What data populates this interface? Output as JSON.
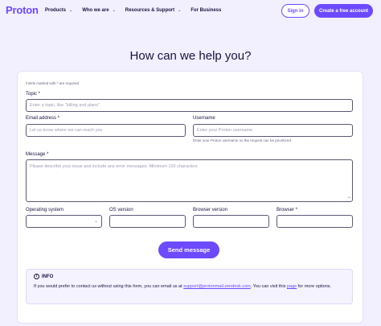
{
  "nav": {
    "logo": "Proton",
    "items": [
      {
        "label": "Products",
        "has_dropdown": true
      },
      {
        "label": "Who we are",
        "has_dropdown": true
      },
      {
        "label": "Resources & Support",
        "has_dropdown": true
      },
      {
        "label": "For Business",
        "has_dropdown": false
      }
    ],
    "signin_label": "Sign in",
    "create_label": "Create a free account"
  },
  "page": {
    "title": "How can we help you?"
  },
  "form": {
    "required_note": "Fields marked with * are required",
    "topic": {
      "label": "Topic *",
      "placeholder": "Enter a topic, like \"billing and plans\""
    },
    "email": {
      "label": "Email address *",
      "placeholder": "Let us know where we can reach you"
    },
    "username": {
      "label": "Username",
      "placeholder": "Enter your Proton username",
      "hint": "Enter your Proton username so the request can be prioritized."
    },
    "message": {
      "label": "Message *",
      "placeholder": "Please describe your issue and include any error messages. Minimum 100 characters"
    },
    "os": {
      "label": "Operating system",
      "value": ""
    },
    "os_version": {
      "label": "OS version",
      "value": ""
    },
    "browser_version": {
      "label": "Browser version",
      "value": ""
    },
    "browser": {
      "label": "Browser *",
      "value": ""
    },
    "send_label": "Send message"
  },
  "info": {
    "icon": "info-circle-icon",
    "title": "INFO",
    "text_before": "If you would prefer to contact us without using this form, you can email us at ",
    "email_link": "support@protonmail.zendesk.com",
    "text_middle": ". You can visit this ",
    "page_link": "page",
    "text_after": " for more options."
  },
  "colors": {
    "accent": "#6d4aff",
    "background": "#f2efff",
    "text": "#1b1340"
  }
}
